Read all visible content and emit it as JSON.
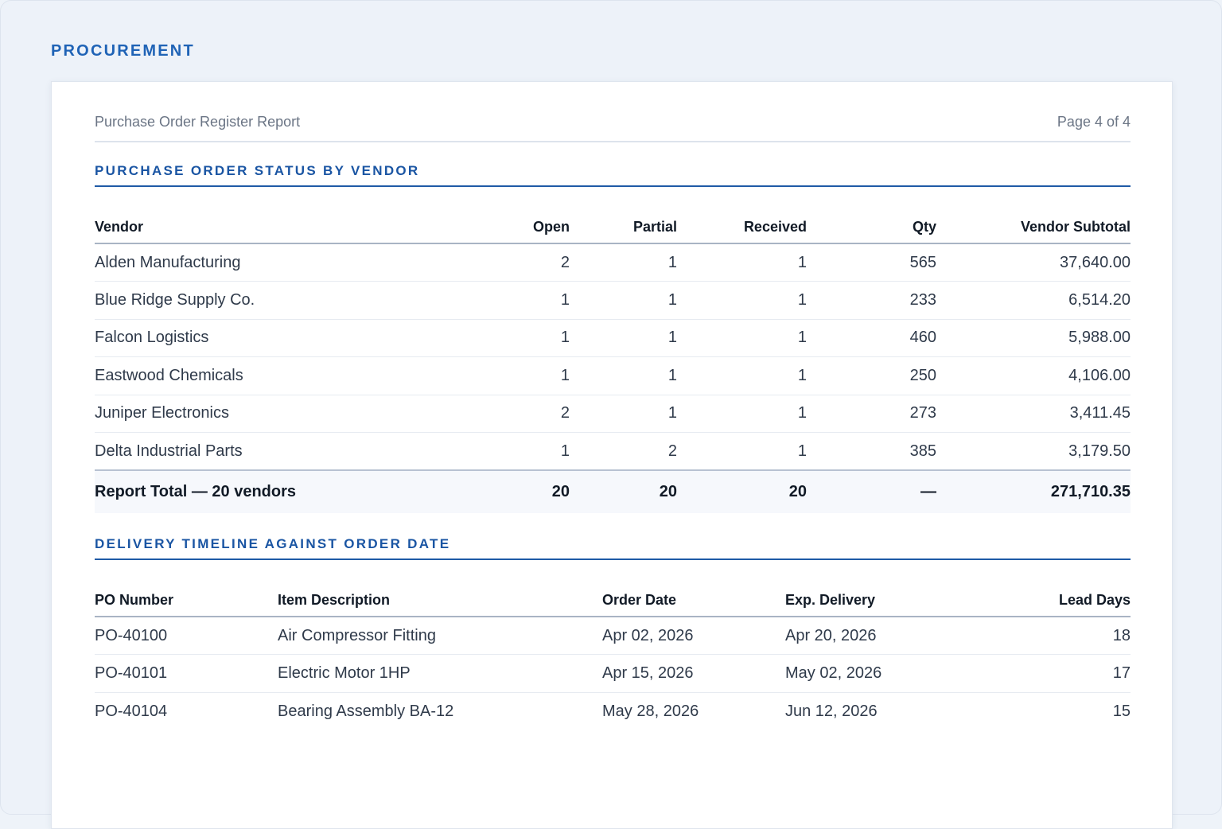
{
  "app": {
    "title": "PROCUREMENT"
  },
  "report": {
    "title": "Purchase Order Register Report",
    "page": "Page 4 of 4"
  },
  "vendor_section": {
    "title": "PURCHASE ORDER STATUS BY VENDOR",
    "columns": [
      "Vendor",
      "Open",
      "Partial",
      "Received",
      "Qty",
      "Vendor Subtotal"
    ],
    "rows": [
      [
        "Alden Manufacturing",
        "2",
        "1",
        "1",
        "565",
        "37,640.00"
      ],
      [
        "Blue Ridge Supply Co.",
        "1",
        "1",
        "1",
        "233",
        "6,514.20"
      ],
      [
        "Falcon Logistics",
        "1",
        "1",
        "1",
        "460",
        "5,988.00"
      ],
      [
        "Eastwood Chemicals",
        "1",
        "1",
        "1",
        "250",
        "4,106.00"
      ],
      [
        "Juniper Electronics",
        "2",
        "1",
        "1",
        "273",
        "3,411.45"
      ],
      [
        "Delta Industrial Parts",
        "1",
        "2",
        "1",
        "385",
        "3,179.50"
      ]
    ],
    "total": [
      "Report Total — 20 vendors",
      "20",
      "20",
      "20",
      "—",
      "271,710.35"
    ]
  },
  "delivery_section": {
    "title": "DELIVERY TIMELINE AGAINST ORDER DATE",
    "columns": [
      "PO Number",
      "Item Description",
      "Order Date",
      "Exp. Delivery",
      "Lead Days"
    ],
    "rows": [
      [
        "PO-40100",
        "Air Compressor Fitting",
        "Apr 02, 2026",
        "Apr 20, 2026",
        "18"
      ],
      [
        "PO-40101",
        "Electric Motor 1HP",
        "Apr 15, 2026",
        "May 02, 2026",
        "17"
      ],
      [
        "PO-40104",
        "Bearing Assembly BA-12",
        "May 28, 2026",
        "Jun 12, 2026",
        "15"
      ]
    ]
  }
}
